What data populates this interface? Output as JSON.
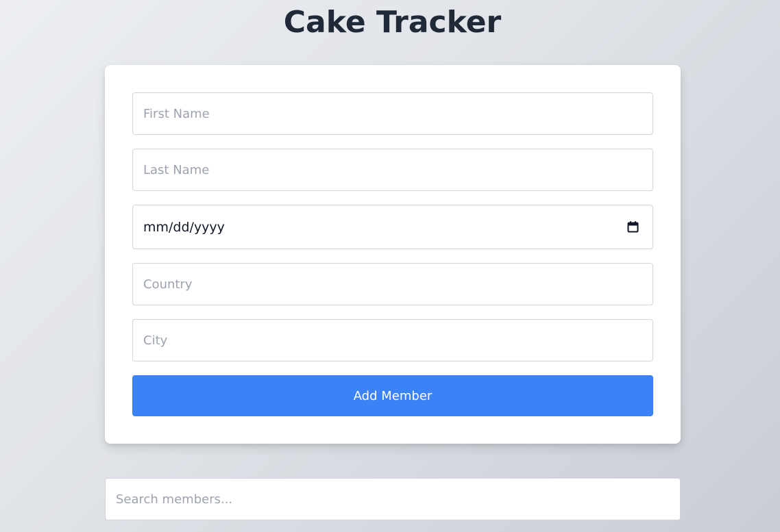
{
  "app": {
    "title": "Cake Tracker"
  },
  "form": {
    "first_name_placeholder": "First Name",
    "last_name_placeholder": "Last Name",
    "date_placeholder": "mm/dd/yyyy",
    "country_placeholder": "Country",
    "city_placeholder": "City",
    "submit_label": "Add Member"
  },
  "search": {
    "placeholder": "Search members..."
  },
  "icons": {
    "date_picker": "calendar-icon"
  },
  "colors": {
    "accent": "#3b82f6",
    "title_text": "#1f2937",
    "placeholder_text": "#9ca3af",
    "card_background": "#ffffff",
    "page_background_start": "#eceef2",
    "page_background_end": "#c8ccd4"
  }
}
